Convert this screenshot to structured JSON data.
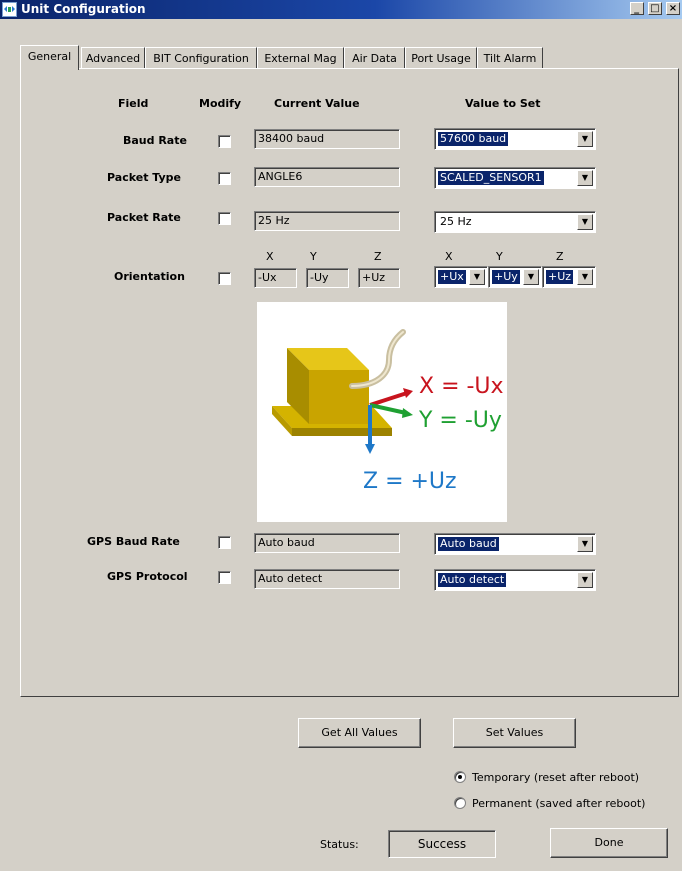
{
  "window": {
    "title": "Unit Configuration",
    "controls": [
      "_",
      "□",
      "×"
    ]
  },
  "tabs": [
    {
      "label": "General",
      "active": true
    },
    {
      "label": "Advanced",
      "active": false
    },
    {
      "label": "BIT Configuration",
      "active": false
    },
    {
      "label": "External Mag",
      "active": false
    },
    {
      "label": "Air Data",
      "active": false
    },
    {
      "label": "Port Usage",
      "active": false
    },
    {
      "label": "Tilt Alarm",
      "active": false
    }
  ],
  "headers": {
    "field": "Field",
    "modify": "Modify",
    "current": "Current Value",
    "set": "Value to Set"
  },
  "rows": {
    "baud_rate": {
      "label": "Baud Rate",
      "current": "38400 baud",
      "set": "57600 baud",
      "modify": false
    },
    "packet_type": {
      "label": "Packet Type",
      "current": "ANGLE6",
      "set": "SCALED_SENSOR1",
      "modify": false
    },
    "packet_rate": {
      "label": "Packet Rate",
      "current": "25 Hz",
      "set": "25 Hz",
      "modify": false
    },
    "orientation": {
      "label": "Orientation",
      "modify": false,
      "axis_labels": [
        "X",
        "Y",
        "Z"
      ],
      "current": [
        "-Ux",
        "-Uy",
        "+Uz"
      ],
      "set": [
        "+Ux",
        "+Uy",
        "+Uz"
      ]
    },
    "gps_baud_rate": {
      "label": "GPS Baud Rate",
      "current": "Auto baud",
      "set": "Auto baud",
      "modify": false
    },
    "gps_protocol": {
      "label": "GPS Protocol",
      "current": "Auto detect",
      "set": "Auto detect",
      "modify": false
    }
  },
  "diagram": {
    "x_label": "X = -Ux",
    "y_label": "Y = -Uy",
    "z_label": "Z = +Uz",
    "colors": {
      "x": "#c8141e",
      "y": "#1fa032",
      "z": "#1e78c8",
      "unit": "#c9a400"
    }
  },
  "buttons": {
    "get_all": "Get All Values",
    "set_values": "Set Values",
    "done": "Done"
  },
  "mode": {
    "temporary": "Temporary (reset after reboot)",
    "permanent": "Permanent (saved after reboot)",
    "selected": "temporary"
  },
  "status": {
    "label": "Status:",
    "value": "Success"
  }
}
